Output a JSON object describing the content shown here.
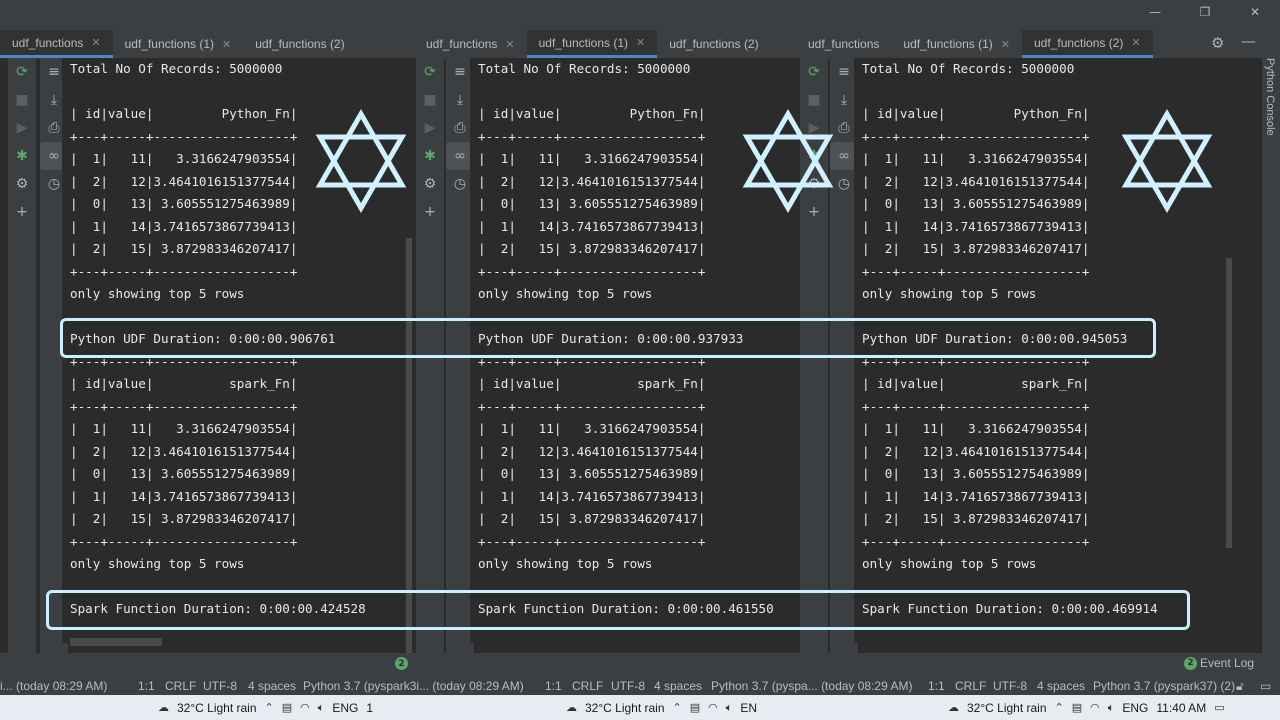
{
  "window": {
    "minimize": "—",
    "restore": "❐",
    "close": "✕"
  },
  "tabs": {
    "panel1": [
      "udf_functions",
      "udf_functions (1)",
      "udf_functions (2)"
    ],
    "panel2": [
      "udf_functions",
      "udf_functions (1)",
      "udf_functions (2)"
    ],
    "panel3": [
      "udf_functions",
      "udf_functions (1)",
      "udf_functions (2)"
    ],
    "active_index": [
      0,
      1,
      2
    ]
  },
  "right_strip": {
    "label": "Python Console",
    "settings_icon": "gear-icon",
    "minimize_icon": "minus-icon"
  },
  "consoles": {
    "c1": {
      "lines": [
        "Total No Of Records: 5000000",
        "",
        "| id|value|         Python_Fn|",
        "+---+-----+------------------+",
        "|  1|   11|   3.3166247903554|",
        "|  2|   12|3.4641016151377544|",
        "|  0|   13| 3.605551275463989|",
        "|  1|   14|3.7416573867739413|",
        "|  2|   15| 3.872983346207417|",
        "+---+-----+------------------+",
        "only showing top 5 rows",
        "",
        "Python UDF Duration: 0:00:00.906761",
        "+---+-----+------------------+",
        "| id|value|          spark_Fn|",
        "+---+-----+------------------+",
        "|  1|   11|   3.3166247903554|",
        "|  2|   12|3.4641016151377544|",
        "|  0|   13| 3.605551275463989|",
        "|  1|   14|3.7416573867739413|",
        "|  2|   15| 3.872983346207417|",
        "+---+-----+------------------+",
        "only showing top 5 rows",
        "",
        "Spark Function Duration: 0:00:00.424528"
      ]
    },
    "c2": {
      "lines": [
        "Total No Of Records: 5000000",
        "",
        "| id|value|         Python_Fn|",
        "+---+-----+------------------+",
        "|  1|   11|   3.3166247903554|",
        "|  2|   12|3.4641016151377544|",
        "|  0|   13| 3.605551275463989|",
        "|  1|   14|3.7416573867739413|",
        "|  2|   15| 3.872983346207417|",
        "+---+-----+------------------+",
        "only showing top 5 rows",
        "",
        "Python UDF Duration: 0:00:00.937933",
        "+---+-----+------------------+",
        "| id|value|          spark_Fn|",
        "+---+-----+------------------+",
        "|  1|   11|   3.3166247903554|",
        "|  2|   12|3.4641016151377544|",
        "|  0|   13| 3.605551275463989|",
        "|  1|   14|3.7416573867739413|",
        "|  2|   15| 3.872983346207417|",
        "+---+-----+------------------+",
        "only showing top 5 rows",
        "",
        "Spark Function Duration: 0:00:00.461550"
      ]
    },
    "c3": {
      "lines": [
        "Total No Of Records: 5000000",
        "",
        "| id|value|         Python_Fn|",
        "+---+-----+------------------+",
        "|  1|   11|   3.3166247903554|",
        "|  2|   12|3.4641016151377544|",
        "|  0|   13| 3.605551275463989|",
        "|  1|   14|3.7416573867739413|",
        "|  2|   15| 3.872983346207417|",
        "+---+-----+------------------+",
        "only showing top 5 rows",
        "",
        "Python UDF Duration: 0:00:00.945053",
        "+---+-----+------------------+",
        "| id|value|          spark_Fn|",
        "+---+-----+------------------+",
        "|  1|   11|   3.3166247903554|",
        "|  2|   12|3.4641016151377544|",
        "|  0|   13| 3.605551275463989|",
        "|  1|   14|3.7416573867739413|",
        "|  2|   15| 3.872983346207417|",
        "+---+-----+------------------+",
        "only showing top 5 rows",
        "",
        "Spark Function Duration: 0:00:00.469914"
      ]
    }
  },
  "toolbar": {
    "rerun_icon": "rerun-icon",
    "stop_icon": "stop-icon",
    "resume_icon": "resume-icon",
    "debug_icon": "bug-icon",
    "settings_icon": "gear-icon",
    "add_icon": "plus-icon",
    "softwrap_icon": "soft-wrap-icon",
    "scroll_end_icon": "scroll-to-end-icon",
    "print_icon": "print-icon",
    "variables_icon": "glasses-icon",
    "history_icon": "clock-icon"
  },
  "status": {
    "left_fragment": "i... (today 08:29 AM)",
    "s1": {
      "pos": "1:1",
      "eol": "CRLF",
      "enc": "UTF-8",
      "indent": "4 spaces",
      "interp": "Python 3.7 (pyspark3i... (today 08:29 AM)"
    },
    "s2": {
      "pos": "1:1",
      "eol": "CRLF",
      "enc": "UTF-8",
      "indent": "4 spaces",
      "interp": "Python 3.7 (pyspa... (today 08:29 AM)"
    },
    "s3": {
      "pos": "1:1",
      "eol": "CRLF",
      "enc": "UTF-8",
      "indent": "4 spaces",
      "interp": "Python 3.7 (pyspark37) (2)"
    },
    "badge_count": "2",
    "event_log": "Event Log"
  },
  "taskbar": {
    "weather1": "32°C  Light rain",
    "weather2": "32°C  Light rain",
    "weather3": "32°C  Light rain",
    "lang": "ENG",
    "lang_short": "EN",
    "count": "1",
    "time": "11:40 AM"
  },
  "colors": {
    "highlight_box": "#c8f0ff",
    "star_stroke": "#d0f2ff",
    "accent_tab": "#4a88c7",
    "badge_green": "#59a869"
  }
}
